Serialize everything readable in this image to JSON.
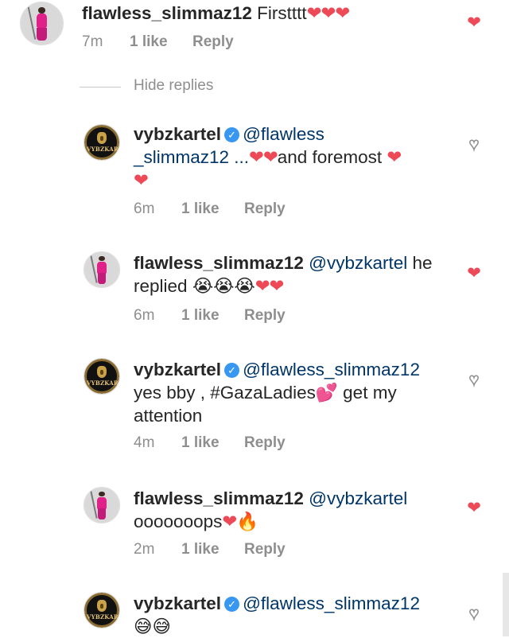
{
  "colors": {
    "heart_liked": "#ed4956",
    "meta_text": "#8e8e8e",
    "verified_badge": "#3897f0"
  },
  "avatars": {
    "flawless": "flawless_slimmaz12 profile picture",
    "vybz": "VybzKartel logo",
    "vybz_text": "VYBZKARTEL"
  },
  "top_comment": {
    "username": "flawless_slimmaz12",
    "text": "Firstttt",
    "emoji": "❤❤❤",
    "time": "7m",
    "likes": "1 like",
    "reply": "Reply",
    "liked": true
  },
  "hide_replies_label": "Hide replies",
  "replies": [
    {
      "username": "vybzkartel",
      "verified": true,
      "mention": "@flawless",
      "line2": "_slimmaz12 ...",
      "emoji_a": "❤❤",
      "line2b": "and foremost",
      "emoji_b": "❤",
      "emoji_c": "❤",
      "time": "6m",
      "likes": "1 like",
      "reply": "Reply",
      "liked": false
    },
    {
      "username": "flawless_slimmaz12",
      "mention": "@vybzkartel",
      "text_a": "he",
      "text_b": "replied",
      "emoji_a": "😭😭😭",
      "emoji_b": "❤❤",
      "time": "6m",
      "likes": "1 like",
      "reply": "Reply",
      "liked": true
    },
    {
      "username": "vybzkartel",
      "verified": true,
      "mention": "@flawless_slimmaz12",
      "line2": "yes bby , #GazaLadies",
      "emoji_a": "💕",
      "line2b": "get my",
      "line3": "attention",
      "time": "4m",
      "likes": "1 like",
      "reply": "Reply",
      "liked": false
    },
    {
      "username": "flawless_slimmaz12",
      "mention": "@vybzkartel",
      "line2": "ooooooops",
      "emoji_a": "❤",
      "emoji_b": "🔥",
      "time": "2m",
      "likes": "1 like",
      "reply": "Reply",
      "liked": true
    },
    {
      "username": "vybzkartel",
      "verified": true,
      "mention": "@flawless_slimmaz12",
      "emoji_a": "😅😅",
      "liked": false
    }
  ],
  "icons": {
    "heart_filled": "heart-filled-icon",
    "heart_outline": "heart-outline-icon",
    "verified": "verified-badge-icon"
  }
}
